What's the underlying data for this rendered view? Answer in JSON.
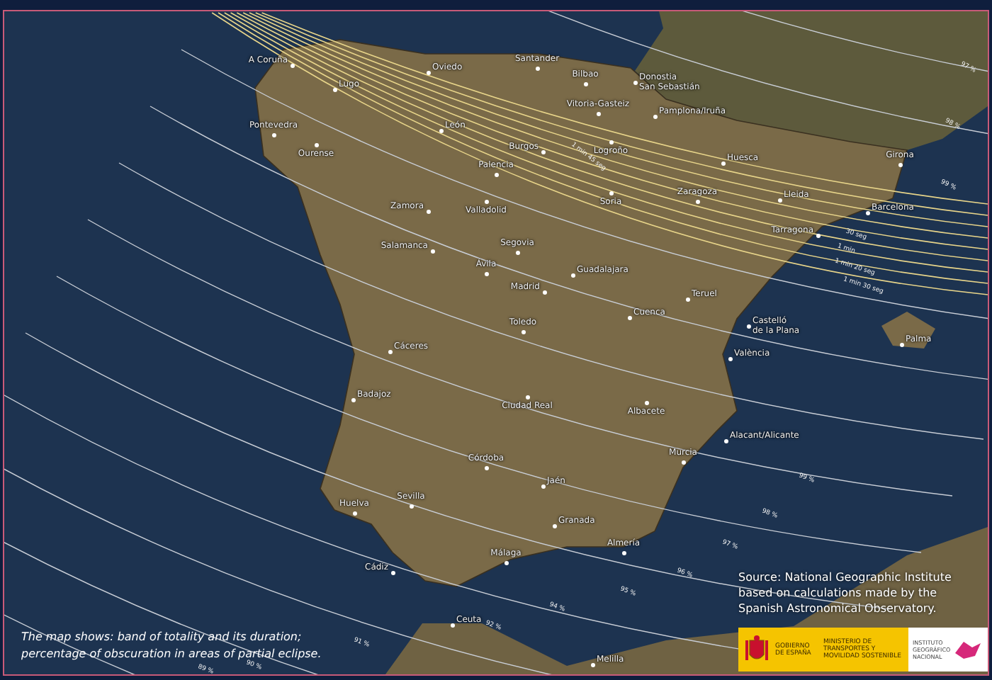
{
  "cities": [
    {
      "lines": [
        "A Coruña"
      ]
    },
    {
      "lines": [
        "Oviedo"
      ]
    },
    {
      "lines": [
        "Santander"
      ]
    },
    {
      "lines": [
        "Lugo"
      ]
    },
    {
      "lines": [
        "Bilbao"
      ]
    },
    {
      "lines": [
        "Donostia",
        "San Sebastián"
      ]
    },
    {
      "lines": [
        "Pontevedra"
      ]
    },
    {
      "lines": [
        "Ourense"
      ]
    },
    {
      "lines": [
        "León"
      ]
    },
    {
      "lines": [
        "Vitoria-Gasteiz"
      ]
    },
    {
      "lines": [
        "Pamplona/Iruña"
      ]
    },
    {
      "lines": [
        "Burgos"
      ]
    },
    {
      "lines": [
        "Logroño"
      ]
    },
    {
      "lines": [
        "Huesca"
      ]
    },
    {
      "lines": [
        "Girona"
      ]
    },
    {
      "lines": [
        "Palencia"
      ]
    },
    {
      "lines": [
        "Zamora"
      ]
    },
    {
      "lines": [
        "Valladolid"
      ]
    },
    {
      "lines": [
        "Soria"
      ]
    },
    {
      "lines": [
        "Zaragoza"
      ]
    },
    {
      "lines": [
        "Lleida"
      ]
    },
    {
      "lines": [
        "Barcelona"
      ]
    },
    {
      "lines": [
        "Tarragona"
      ]
    },
    {
      "lines": [
        "Salamanca"
      ]
    },
    {
      "lines": [
        "Segovia"
      ]
    },
    {
      "lines": [
        "Ávila"
      ]
    },
    {
      "lines": [
        "Guadalajara"
      ]
    },
    {
      "lines": [
        "Madrid"
      ]
    },
    {
      "lines": [
        "Teruel"
      ]
    },
    {
      "lines": [
        "Cuenca"
      ]
    },
    {
      "lines": [
        "Castelló",
        "de la Plana"
      ]
    },
    {
      "lines": [
        "Palma"
      ]
    },
    {
      "lines": [
        "Toledo"
      ]
    },
    {
      "lines": [
        "Cáceres"
      ]
    },
    {
      "lines": [
        "València"
      ]
    },
    {
      "lines": [
        "Badajoz"
      ]
    },
    {
      "lines": [
        "Ciudad Real"
      ]
    },
    {
      "lines": [
        "Albacete"
      ]
    },
    {
      "lines": [
        "Alacant/Alicante"
      ]
    },
    {
      "lines": [
        "Córdoba"
      ]
    },
    {
      "lines": [
        "Murcia"
      ]
    },
    {
      "lines": [
        "Jaén"
      ]
    },
    {
      "lines": [
        "Huelva"
      ]
    },
    {
      "lines": [
        "Sevilla"
      ]
    },
    {
      "lines": [
        "Granada"
      ]
    },
    {
      "lines": [
        "Almería"
      ]
    },
    {
      "lines": [
        "Málaga"
      ]
    },
    {
      "lines": [
        "Cádiz"
      ]
    },
    {
      "lines": [
        "Ceuta"
      ]
    },
    {
      "lines": [
        "Melilla"
      ]
    }
  ],
  "duration_labels": [
    "1 min 45 seg",
    "30 seg",
    "1 min",
    "1 min 20 seg",
    "1 min 30 seg"
  ],
  "percent_labels": [
    "97 %",
    "98 %",
    "99 %",
    "99 %",
    "98 %",
    "97 %",
    "96 %",
    "95 %",
    "94 %",
    "92 %",
    "91 %",
    "90 %",
    "89 %"
  ],
  "caption": {
    "lines": [
      "The map shows: band of totality and its duration;",
      "percentage of obscuration in areas of partial eclipse."
    ]
  },
  "source": {
    "lines": [
      "Source: National Geographic Institute",
      "based on calculations made by the",
      "Spanish Astronomical Observatory."
    ]
  },
  "logos": {
    "government": "GOBIERNO DE ESPAÑA",
    "ministry": "MINISTERIO DE TRANSPORTES Y MOVILIDAD SOSTENIBLE",
    "institute": "INSTITUTO GEOGRÁFICO NACIONAL"
  }
}
